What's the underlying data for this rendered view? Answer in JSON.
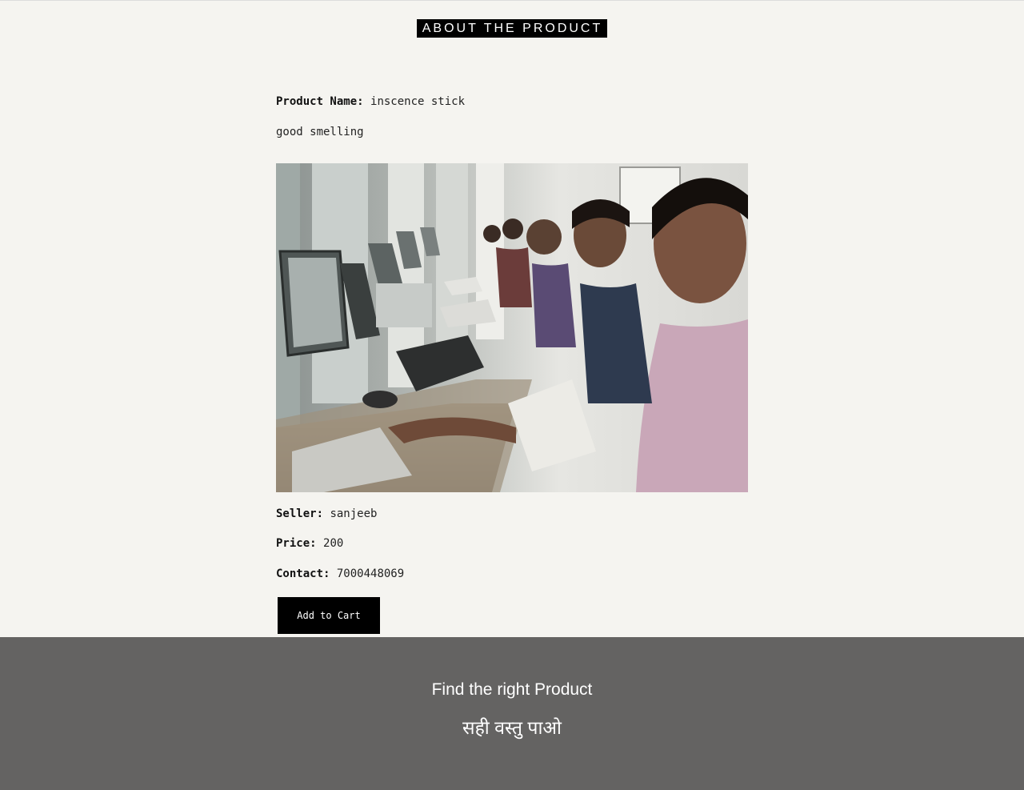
{
  "header": {
    "title": "ABOUT THE PRODUCT"
  },
  "product": {
    "name_label": "Product Name:",
    "name_value": "inscence stick",
    "description": "good smelling",
    "image_alt": "women smiling at computers in a classroom",
    "seller_label": "Seller:",
    "seller_value": "sanjeeb",
    "price_label": "Price:",
    "price_value": "200",
    "contact_label": "Contact:",
    "contact_value": "7000448069",
    "add_to_cart_label": "Add to Cart"
  },
  "footer": {
    "tagline_en": "Find the right Product",
    "tagline_hi": "सही वस्तु पाओ"
  }
}
